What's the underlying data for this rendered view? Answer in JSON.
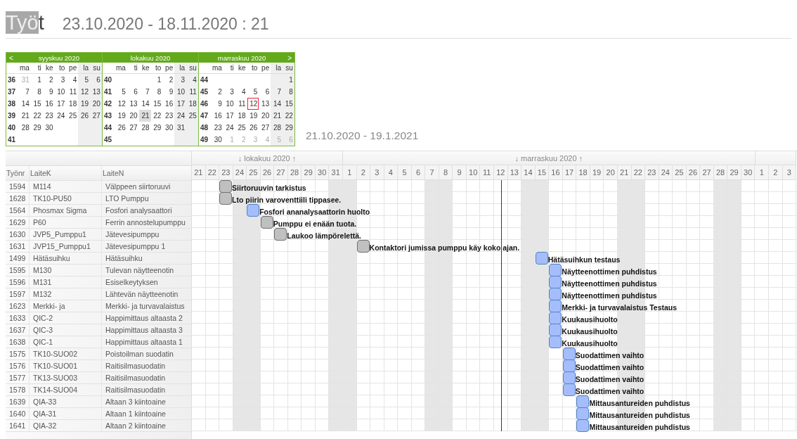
{
  "title_parts": [
    {
      "text": "Työ",
      "selected": true
    },
    {
      "text": "t",
      "selected": false
    }
  ],
  "subtitle": "23.10.2020 - 18.11.2020 : 21",
  "calendar": {
    "prev": "<",
    "next": ">",
    "months": [
      {
        "label": "syyskuu 2020",
        "weekdays": [
          "ma",
          "ti",
          "ke",
          "to",
          "pe",
          "la",
          "su"
        ],
        "weeks": [
          {
            "number": "36",
            "lead": [
              "31"
            ],
            "days": [
              "1",
              "2",
              "3",
              "4",
              "5",
              "6"
            ]
          },
          {
            "number": "37",
            "days": [
              "7",
              "8",
              "9",
              "10",
              "11",
              "12",
              "13"
            ]
          },
          {
            "number": "38",
            "days": [
              "14",
              "15",
              "16",
              "17",
              "18",
              "19",
              "20"
            ]
          },
          {
            "number": "39",
            "days": [
              "21",
              "22",
              "23",
              "24",
              "25",
              "26",
              "27"
            ]
          },
          {
            "number": "40",
            "days": [
              "28",
              "29",
              "30"
            ]
          },
          {
            "number": "41"
          }
        ]
      },
      {
        "label": "lokakuu 2020",
        "weekdays": [
          "ma",
          "ti",
          "ke",
          "to",
          "pe",
          "la",
          "su"
        ],
        "weeks": [
          {
            "number": "40",
            "days": [
              "1",
              "2",
              "3",
              "4"
            ]
          },
          {
            "number": "41",
            "days": [
              "5",
              "6",
              "7",
              "8",
              "9",
              "10",
              "11"
            ]
          },
          {
            "number": "42",
            "days": [
              "12",
              "13",
              "14",
              "15",
              "16",
              "17",
              "18"
            ]
          },
          {
            "number": "43",
            "days": [
              "19",
              "20",
              {
                "label": "21",
                "selected": true,
                "today": false
              },
              "22",
              "23",
              "24",
              "25"
            ]
          },
          {
            "number": "44",
            "days": [
              "26",
              "27",
              "28",
              "29",
              "30",
              "31"
            ]
          },
          {
            "number": "45"
          }
        ]
      },
      {
        "label": "marraskuu 2020",
        "weekdays": [
          "ma",
          "ti",
          "ke",
          "to",
          "pe",
          "la",
          "su"
        ],
        "weeks": [
          {
            "number": "44",
            "days": [
              "1"
            ]
          },
          {
            "number": "45",
            "days": [
              "2",
              "3",
              "4",
              "5",
              "6",
              "7",
              "8"
            ]
          },
          {
            "number": "46",
            "days": [
              "9",
              "10",
              "11",
              {
                "label": "12",
                "selected": false,
                "today": true
              },
              "13",
              "14",
              "15"
            ]
          },
          {
            "number": "47",
            "days": [
              "16",
              "17",
              "18",
              "19",
              "20",
              "21",
              "22"
            ]
          },
          {
            "number": "48",
            "days": [
              "23",
              "24",
              "25",
              "26",
              "27",
              "28",
              "29"
            ]
          },
          {
            "number": "49",
            "days": [
              "30"
            ],
            "trail": [
              "1",
              "2",
              "3",
              "4",
              "5",
              "6"
            ]
          }
        ]
      }
    ]
  },
  "range": "21.10.2020 - 19.1.2021",
  "gantt": {
    "columns": [
      "Työnr",
      "LaiteK",
      "LaiteN"
    ],
    "months": [
      {
        "label": "lokakuu 2020",
        "down": "↓",
        "up": "↑",
        "days": [
          {
            "label": "21",
            "weekend": false
          },
          {
            "label": "22",
            "weekend": false
          },
          {
            "label": "23",
            "weekend": false
          },
          {
            "label": "24",
            "weekend": true
          },
          {
            "label": "25",
            "weekend": true
          },
          {
            "label": "26",
            "weekend": false
          },
          {
            "label": "27",
            "weekend": false
          },
          {
            "label": "28",
            "weekend": false
          },
          {
            "label": "29",
            "weekend": false
          },
          {
            "label": "30",
            "weekend": false
          },
          {
            "label": "31",
            "weekend": true
          }
        ]
      },
      {
        "label": "marraskuu 2020",
        "down": "↓",
        "up": "↑",
        "days": [
          {
            "label": "1",
            "weekend": true
          },
          {
            "label": "2",
            "weekend": false
          },
          {
            "label": "3",
            "weekend": false
          },
          {
            "label": "4",
            "weekend": false
          },
          {
            "label": "5",
            "weekend": false
          },
          {
            "label": "6",
            "weekend": false
          },
          {
            "label": "7",
            "weekend": true
          },
          {
            "label": "8",
            "weekend": true
          },
          {
            "label": "9",
            "weekend": false
          },
          {
            "label": "10",
            "weekend": false
          },
          {
            "label": "11",
            "weekend": false
          },
          {
            "label": "12",
            "weekend": false,
            "today": true
          },
          {
            "label": "13",
            "weekend": false
          },
          {
            "label": "14",
            "weekend": true
          },
          {
            "label": "15",
            "weekend": true
          },
          {
            "label": "16",
            "weekend": false
          },
          {
            "label": "17",
            "weekend": false
          },
          {
            "label": "18",
            "weekend": false
          },
          {
            "label": "19",
            "weekend": false
          },
          {
            "label": "20",
            "weekend": false
          },
          {
            "label": "21",
            "weekend": true
          },
          {
            "label": "22",
            "weekend": true
          },
          {
            "label": "23",
            "weekend": false
          },
          {
            "label": "24",
            "weekend": false
          },
          {
            "label": "25",
            "weekend": false
          },
          {
            "label": "26",
            "weekend": false
          },
          {
            "label": "27",
            "weekend": false
          },
          {
            "label": "28",
            "weekend": true
          },
          {
            "label": "29",
            "weekend": true
          },
          {
            "label": "30",
            "weekend": false
          }
        ]
      },
      {
        "days": [
          {
            "label": "1",
            "weekend": false
          },
          {
            "label": "2",
            "weekend": false
          },
          {
            "label": "3",
            "weekend": false
          }
        ]
      }
    ],
    "rows": [
      {
        "cells": [
          "1594",
          "M114",
          "Välppeen siirtoruuvi"
        ],
        "task": {
          "label": "Siirtoruuvin tarkistus",
          "level": 0.0455,
          "color": "#c0c0c0"
        }
      },
      {
        "cells": [
          "1628",
          "TK10-PU50",
          "LTO Pumppu"
        ],
        "task": {
          "label": "Lto piirin varoventtiili tippasee.",
          "level": 0.0455,
          "color": "#c0c0c0"
        }
      },
      {
        "cells": [
          "1564",
          "Phosmax Sigma",
          "Fosfori analysaattori"
        ],
        "task": {
          "label": "Fosfori ananalysaattorin huolto",
          "level": 0.0909,
          "color": "#a6bdfb"
        }
      },
      {
        "cells": [
          "1629",
          "P60",
          "Ferrin annostelupumppu"
        ],
        "task": {
          "label": "Pumppu ei enään tuota.",
          "level": 0.1136,
          "color": "#c0c0c0"
        }
      },
      {
        "cells": [
          "1630",
          "JVP5_Pumppu1",
          "Jätevesipumppu"
        ],
        "task": {
          "label": "Laukoo lämpörelettä.",
          "level": 0.1364,
          "color": "#c0c0c0"
        }
      },
      {
        "cells": [
          "1631",
          "JVP15_Pumppu1",
          "Jätevesipumppu 1"
        ],
        "task": {
          "label": "Kontaktori jumissa pumppu käy koko ajan.",
          "level": 0.2727,
          "color": "#c0c0c0"
        }
      },
      {
        "cells": [
          "1499",
          "Hätäsuihku",
          "Hätäsuihku"
        ],
        "task": {
          "label": "Hätäsuihkun testaus",
          "level": 0.5682,
          "color": "#a6bdfb"
        }
      },
      {
        "cells": [
          "1595",
          "M130",
          "Tulevan näytteenotin"
        ],
        "task": {
          "label": "Näytteenottimen puhdistus",
          "level": 0.5909,
          "color": "#a6bdfb"
        }
      },
      {
        "cells": [
          "1596",
          "M131",
          "Esiselkeytyksen"
        ],
        "task": {
          "label": "Näytteenottimen puhdistus",
          "level": 0.5909,
          "color": "#a6bdfb"
        }
      },
      {
        "cells": [
          "1597",
          "M132",
          "Lähtevän näytteenotin"
        ],
        "task": {
          "label": "Näytteenottimen puhdistus",
          "level": 0.5909,
          "color": "#a6bdfb"
        }
      },
      {
        "cells": [
          "1623",
          "Merkki- ja",
          "Merkki- ja turvavalaistus"
        ],
        "task": {
          "label": "Merkki- ja turvavalaistus Testaus",
          "level": 0.5909,
          "color": "#a6bdfb"
        }
      },
      {
        "cells": [
          "1633",
          "QIC-2",
          "Happimittaus altaasta 2"
        ],
        "task": {
          "label": "Kuukausihuolto",
          "level": 0.5909,
          "color": "#a6bdfb"
        }
      },
      {
        "cells": [
          "1637",
          "QIC-3",
          "Happimittaus altaasta 3"
        ],
        "task": {
          "label": "Kuukausihuolto",
          "level": 0.5909,
          "color": "#a6bdfb"
        }
      },
      {
        "cells": [
          "1638",
          "QIC-1",
          "Happimittaus altaasta 1"
        ],
        "task": {
          "label": "Kuukausihuolto",
          "level": 0.5909,
          "color": "#a6bdfb"
        }
      },
      {
        "cells": [
          "1575",
          "TK10-SUO02",
          "Poistoilman suodatin"
        ],
        "task": {
          "label": "Suodattimen vaihto",
          "level": 0.6136,
          "color": "#a6bdfb"
        }
      },
      {
        "cells": [
          "1576",
          "TK10-SUO01",
          "Raitisilmasuodatin"
        ],
        "task": {
          "label": "Suodattimen vaihto",
          "level": 0.6136,
          "color": "#a6bdfb"
        }
      },
      {
        "cells": [
          "1577",
          "TK13-SUO03",
          "Raitisilmasuodatin"
        ],
        "task": {
          "label": "Suodattimen vaihto",
          "level": 0.6136,
          "color": "#a6bdfb"
        }
      },
      {
        "cells": [
          "1578",
          "TK14-SUO04",
          "Raitisilmasuodatin"
        ],
        "task": {
          "label": "Suodattimen vaihto",
          "level": 0.6136,
          "color": "#a6bdfb"
        }
      },
      {
        "cells": [
          "1639",
          "QIA-33",
          "Altaan 3 kiintoaine"
        ],
        "task": {
          "label": "Mittausantureiden puhdistus",
          "level": 0.6364,
          "color": "#a6bdfb"
        }
      },
      {
        "cells": [
          "1640",
          "QIA-31",
          "Altaan 1 kiintoaine"
        ],
        "task": {
          "label": "Mittausantureiden puhdistus",
          "level": 0.6364,
          "color": "#a6bdfb"
        }
      },
      {
        "cells": [
          "1641",
          "QIA-32",
          "Altaan 2 kiintoaine"
        ],
        "task": {
          "label": "Mittausantureiden puhdistus",
          "level": 0.6364,
          "color": "#a6bdfb"
        }
      }
    ]
  }
}
